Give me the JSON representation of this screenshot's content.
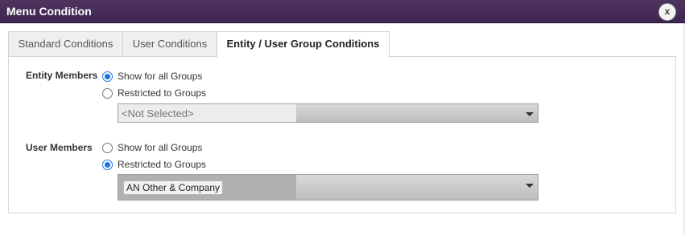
{
  "dialog": {
    "title": "Menu Condition",
    "close_label": "x"
  },
  "tabs": [
    {
      "label": "Standard Conditions",
      "active": false
    },
    {
      "label": "User Conditions",
      "active": false
    },
    {
      "label": "Entity / User Group Conditions",
      "active": true
    }
  ],
  "entity_members": {
    "label": "Entity Members",
    "options": [
      {
        "label": "Show for all Groups",
        "checked": true
      },
      {
        "label": "Restricted to Groups",
        "checked": false
      }
    ],
    "select": {
      "value": "<Not Selected>",
      "disabled": true
    }
  },
  "user_members": {
    "label": "User Members",
    "options": [
      {
        "label": "Show for all Groups",
        "checked": false
      },
      {
        "label": "Restricted to Groups",
        "checked": true
      }
    ],
    "select": {
      "selected_tags": [
        "AN Other & Company"
      ]
    }
  },
  "colors": {
    "titlebar": "#4a2f5a",
    "radio_checked": "#1a73e8"
  }
}
